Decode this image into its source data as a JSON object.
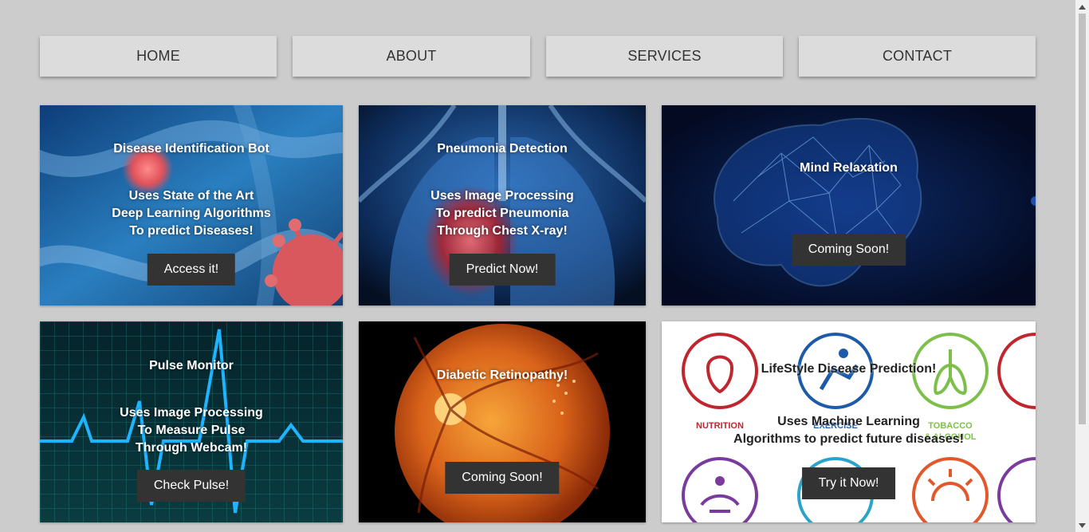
{
  "nav": {
    "items": [
      {
        "label": "HOME"
      },
      {
        "label": "ABOUT"
      },
      {
        "label": "SERVICES"
      },
      {
        "label": "CONTACT"
      }
    ]
  },
  "cards": [
    {
      "title": "Disease Identification Bot",
      "desc": [
        "Uses State of the Art",
        "Deep Learning Algorithms",
        "To predict Diseases!"
      ],
      "button": "Access it!",
      "icon": "virus-icon"
    },
    {
      "title": "Pneumonia Detection",
      "desc": [
        "Uses Image Processing",
        "To predict Pneumonia",
        "Through Chest X-ray!"
      ],
      "button": "Predict Now!",
      "icon": "lungs-icon"
    },
    {
      "title": "Mind Relaxation",
      "button": "Coming Soon!",
      "icon": "brain-icon"
    },
    {
      "title": "Pulse Monitor",
      "desc": [
        "Uses Image Processing",
        "To Measure Pulse",
        "Through Webcam!"
      ],
      "button": "Check Pulse!",
      "icon": "heartbeat-icon"
    },
    {
      "title": "Diabetic Retinopathy!",
      "button": "Coming Soon!",
      "icon": "retina-icon"
    },
    {
      "title": "LifeStyle Disease Prediction!",
      "desc": [
        "Uses Machine Learning",
        "Algorithms to predict future diseases!"
      ],
      "button": "Try it Now!",
      "bg_labels": [
        "NUTRITION",
        "EXERCISE",
        "TOBACCO",
        "& ALCOHOL"
      ],
      "icon": "lifestyle-icons"
    }
  ]
}
